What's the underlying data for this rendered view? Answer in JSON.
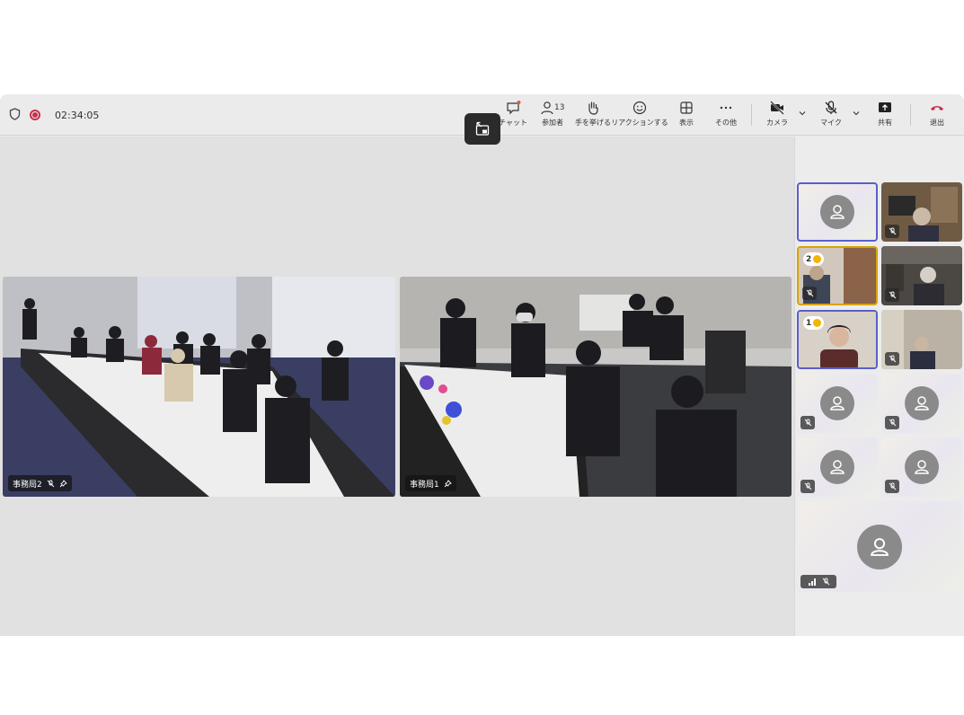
{
  "toolbar": {
    "timer": "02:34:05",
    "participant_count": "13",
    "buttons": {
      "chat": "チャット",
      "people": "参加者",
      "raise_hand": "手を挙げる",
      "react": "リアクションする",
      "view": "表示",
      "more": "その他",
      "camera": "カメラ",
      "mic": "マイク",
      "share": "共有",
      "leave": "退出"
    }
  },
  "stage": {
    "videos": [
      {
        "label": "事務局2"
      },
      {
        "label": "事務局1"
      }
    ]
  },
  "gallery": {
    "hand_badges": [
      "2",
      "1"
    ]
  },
  "colors": {
    "accent": "#5b5fc7",
    "leave": "#c4314b",
    "hand": "#f2b600"
  }
}
